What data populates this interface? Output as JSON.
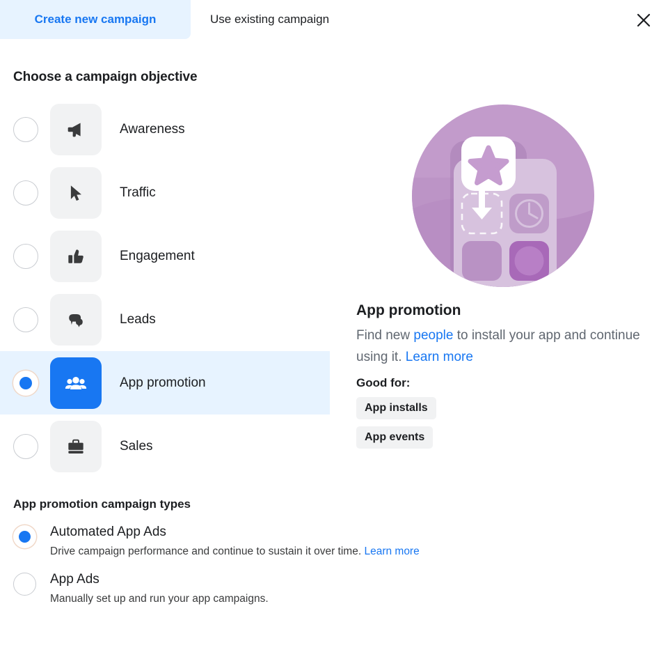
{
  "tabs": {
    "create_new": "Create new campaign",
    "use_existing": "Use existing campaign",
    "close_icon": "close-icon",
    "active_color": "#1877f2",
    "active_bg": "#e7f3ff"
  },
  "objective_section": {
    "title": "Choose a campaign objective",
    "selected": "App promotion",
    "selected_bg": "#e7f3ff",
    "selected_icon_bg": "#1877f2",
    "items": [
      {
        "label": "Awareness",
        "icon": "megaphone-icon",
        "selected": false
      },
      {
        "label": "Traffic",
        "icon": "cursor-icon",
        "selected": false
      },
      {
        "label": "Engagement",
        "icon": "thumbs-up-icon",
        "selected": false
      },
      {
        "label": "Leads",
        "icon": "chat-bubbles-icon",
        "selected": false
      },
      {
        "label": "App promotion",
        "icon": "people-icon",
        "selected": true
      },
      {
        "label": "Sales",
        "icon": "briefcase-icon",
        "selected": false
      }
    ]
  },
  "detail": {
    "illustration": "app-promotion-illustration",
    "title": "App promotion",
    "desc_part1": "Find new ",
    "desc_link1": "people",
    "desc_part2": " to install your app and continue using it. ",
    "desc_link2": "Learn more",
    "good_for_label": "Good for:",
    "badges": [
      "App installs",
      "App events"
    ]
  },
  "campaign_types": {
    "title": "App promotion campaign types",
    "items": [
      {
        "name": "Automated App Ads",
        "desc": "Drive campaign performance and continue to sustain it over time.",
        "link": "Learn more",
        "selected": true
      },
      {
        "name": "App Ads",
        "desc": "Manually set up and run your app campaigns.",
        "link": "",
        "selected": false
      }
    ]
  }
}
